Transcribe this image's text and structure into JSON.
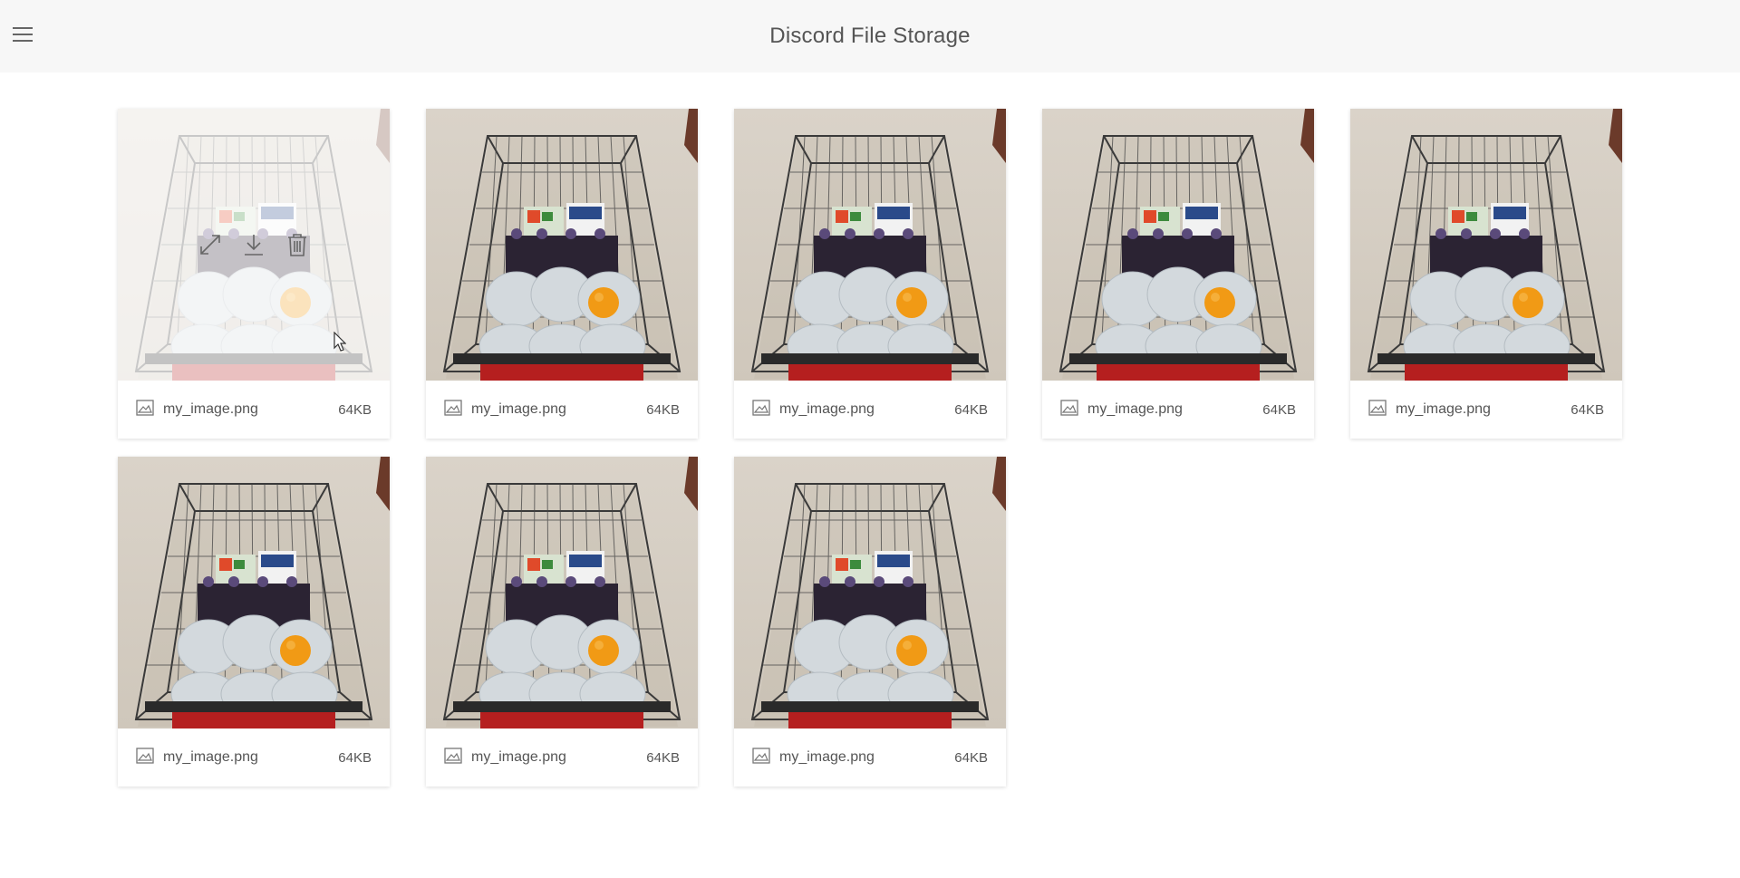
{
  "app": {
    "title": "Discord File Storage"
  },
  "files": [
    {
      "name": "my_image.png",
      "size": "64KB",
      "hovered": true
    },
    {
      "name": "my_image.png",
      "size": "64KB",
      "hovered": false
    },
    {
      "name": "my_image.png",
      "size": "64KB",
      "hovered": false
    },
    {
      "name": "my_image.png",
      "size": "64KB",
      "hovered": false
    },
    {
      "name": "my_image.png",
      "size": "64KB",
      "hovered": false
    },
    {
      "name": "my_image.png",
      "size": "64KB",
      "hovered": false
    },
    {
      "name": "my_image.png",
      "size": "64KB",
      "hovered": false
    },
    {
      "name": "my_image.png",
      "size": "64KB",
      "hovered": false
    }
  ],
  "overlay_actions": [
    "expand-icon",
    "download-icon",
    "trash-icon"
  ],
  "colors": {
    "topbar": "#f7f7f7",
    "text": "#555555"
  }
}
